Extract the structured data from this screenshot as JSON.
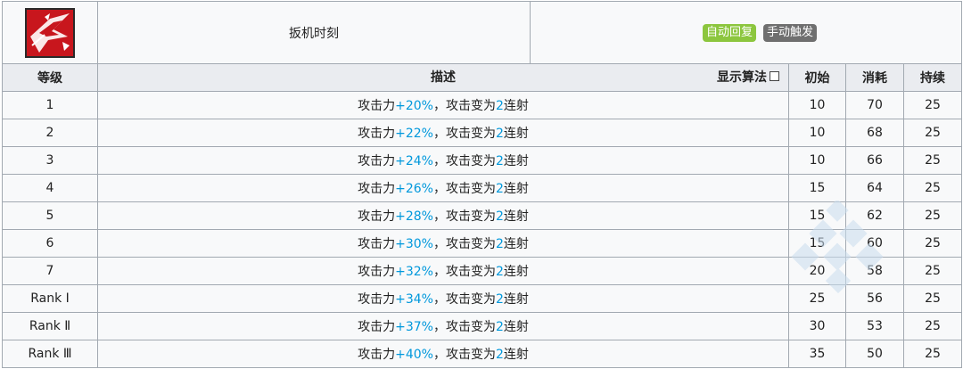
{
  "skill": {
    "name": "扳机时刻",
    "icon": "skill-icon",
    "tags": [
      {
        "label": "自动回复",
        "color": "#8cc63e"
      },
      {
        "label": "手动触发",
        "color": "#6f6f6f"
      }
    ]
  },
  "columns": {
    "level": "等级",
    "description": "描述",
    "show_formula": "显示算法",
    "initial": "初始",
    "cost": "消耗",
    "duration": "持续"
  },
  "rows": [
    {
      "level": "1",
      "p1": "攻击力",
      "v1": "+20%",
      "p2": "，攻击变为",
      "v2": "2",
      "p3": "连射",
      "initial": "10",
      "cost": "70",
      "duration": "25"
    },
    {
      "level": "2",
      "p1": "攻击力",
      "v1": "+22%",
      "p2": "，攻击变为",
      "v2": "2",
      "p3": "连射",
      "initial": "10",
      "cost": "68",
      "duration": "25"
    },
    {
      "level": "3",
      "p1": "攻击力",
      "v1": "+24%",
      "p2": "，攻击变为",
      "v2": "2",
      "p3": "连射",
      "initial": "10",
      "cost": "66",
      "duration": "25"
    },
    {
      "level": "4",
      "p1": "攻击力",
      "v1": "+26%",
      "p2": "，攻击变为",
      "v2": "2",
      "p3": "连射",
      "initial": "15",
      "cost": "64",
      "duration": "25"
    },
    {
      "level": "5",
      "p1": "攻击力",
      "v1": "+28%",
      "p2": "，攻击变为",
      "v2": "2",
      "p3": "连射",
      "initial": "15",
      "cost": "62",
      "duration": "25"
    },
    {
      "level": "6",
      "p1": "攻击力",
      "v1": "+30%",
      "p2": "，攻击变为",
      "v2": "2",
      "p3": "连射",
      "initial": "15",
      "cost": "60",
      "duration": "25"
    },
    {
      "level": "7",
      "p1": "攻击力",
      "v1": "+32%",
      "p2": "，攻击变为",
      "v2": "2",
      "p3": "连射",
      "initial": "20",
      "cost": "58",
      "duration": "25"
    },
    {
      "level": "Rank Ⅰ",
      "p1": "攻击力",
      "v1": "+34%",
      "p2": "，攻击变为",
      "v2": "2",
      "p3": "连射",
      "initial": "25",
      "cost": "56",
      "duration": "25"
    },
    {
      "level": "Rank Ⅱ",
      "p1": "攻击力",
      "v1": "+37%",
      "p2": "，攻击变为",
      "v2": "2",
      "p3": "连射",
      "initial": "30",
      "cost": "53",
      "duration": "25"
    },
    {
      "level": "Rank Ⅲ",
      "p1": "攻击力",
      "v1": "+40%",
      "p2": "，攻击变为",
      "v2": "2",
      "p3": "连射",
      "initial": "35",
      "cost": "50",
      "duration": "25"
    }
  ],
  "colors": {
    "highlight": "#0098dc",
    "header_bg": "#eaecf0",
    "cell_bg": "#f8f9fa",
    "border": "#a2a9b1"
  }
}
